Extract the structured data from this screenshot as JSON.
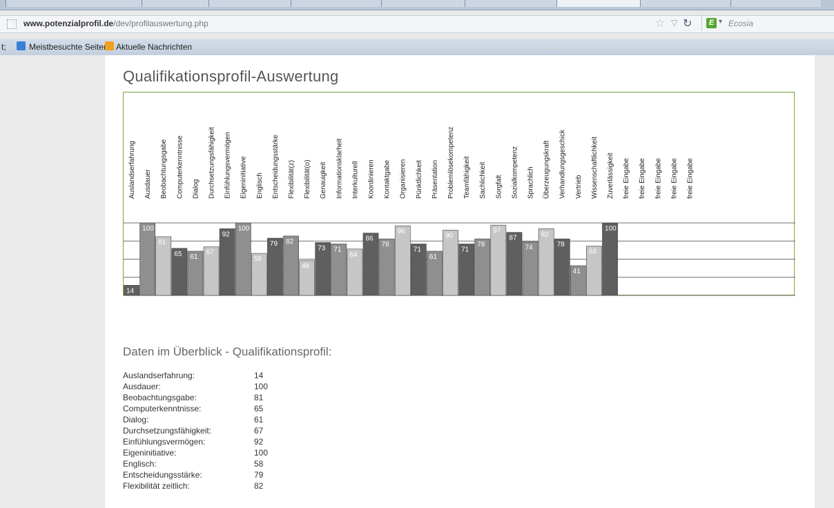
{
  "browser": {
    "url_domain": "www.potenzialprofil.de",
    "url_path": "/dev/profilauswertung.php",
    "search_engine": "Ecosia",
    "bookmarks": [
      "t;",
      "Meistbesuchte Seiten",
      "Aktuelle Nachrichten"
    ]
  },
  "page": {
    "title": "Qualifikationsprofil-Auswertung",
    "overview_title": "Daten im Überblick - Qualifikationsprofil:"
  },
  "chart_data": {
    "type": "bar",
    "categories": [
      "Auslandserfahrung",
      "Ausdauer",
      "Beobachtungsgabe",
      "Computerkenntnisse",
      "Dialog",
      "Durchsetzungsfähigkeit",
      "Einfühlungsvermögen",
      "Eigeninitiative",
      "Englisch",
      "Entscheidungsstärke",
      "Flexibilität(z)",
      "Flexibilität(o)",
      "Genauigkeit",
      "Informationsklarheit",
      "Interkulturell",
      "Koordinieren",
      "Kontaktgabe",
      "Organisieren",
      "Pünktlichkeit",
      "Präsentation",
      "Problemlösekompetenz",
      "Teamfähigkeit",
      "Sachlichkeit",
      "Sorgfalt",
      "Sozialkompetenz",
      "Sprachlich",
      "Überzeugungskraft",
      "Verhandlungsgeschick",
      "Vertrieb",
      "Wissenschaftlichkeit",
      "Zuverlässigkeit",
      "freie Eingabe",
      "freie Eingabe",
      "freie Eingabe",
      "freie Eingabe",
      "freie Eingabe"
    ],
    "values": [
      14,
      100,
      81,
      65,
      61,
      67,
      92,
      100,
      58,
      79,
      82,
      48,
      73,
      71,
      64,
      86,
      78,
      96,
      71,
      61,
      90,
      71,
      78,
      97,
      87,
      74,
      92,
      78,
      41,
      68,
      100,
      null,
      null,
      null,
      null,
      null
    ],
    "ylim": [
      0,
      100
    ],
    "grid": true,
    "colors": [
      "#5f5f5f",
      "#8f8f8f",
      "#c6c6c6"
    ],
    "border_color": "#7aa33c"
  },
  "data_list": [
    {
      "label": "Auslandserfahrung:",
      "value": "14"
    },
    {
      "label": "Ausdauer:",
      "value": "100"
    },
    {
      "label": "Beobachtungsgabe:",
      "value": "81"
    },
    {
      "label": "Computerkenntnisse:",
      "value": "65"
    },
    {
      "label": "Dialog:",
      "value": "61"
    },
    {
      "label": "Durchsetzungsfähigkeit:",
      "value": "67"
    },
    {
      "label": "Einfühlungsvermögen:",
      "value": "92"
    },
    {
      "label": "Eigeninitiative:",
      "value": "100"
    },
    {
      "label": "Englisch:",
      "value": "58"
    },
    {
      "label": "Entscheidungsstärke:",
      "value": "79"
    },
    {
      "label": "Flexibilität zeitlich:",
      "value": "82"
    }
  ]
}
